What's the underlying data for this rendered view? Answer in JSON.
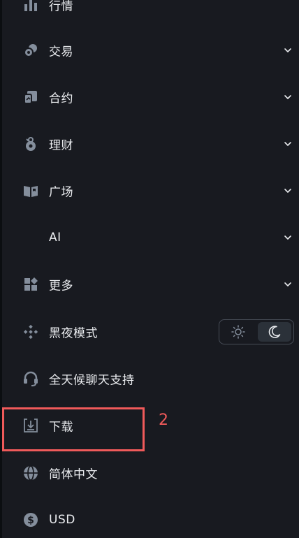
{
  "menu": {
    "items": [
      {
        "id": "market",
        "label": "行情",
        "icon": "bar-chart-icon",
        "chevron": false
      },
      {
        "id": "trade",
        "label": "交易",
        "icon": "trade-icon",
        "chevron": true
      },
      {
        "id": "contract",
        "label": "合约",
        "icon": "contract-icon",
        "chevron": true
      },
      {
        "id": "finance",
        "label": "理财",
        "icon": "finance-icon",
        "chevron": true
      },
      {
        "id": "square",
        "label": "广场",
        "icon": "book-icon",
        "chevron": true
      },
      {
        "id": "ai",
        "label": "AI",
        "icon": "",
        "chevron": true
      },
      {
        "id": "more",
        "label": "更多",
        "icon": "grid-icon",
        "chevron": true
      },
      {
        "id": "dark-mode",
        "label": "黑夜模式",
        "icon": "diamond-icon",
        "chevron": false
      },
      {
        "id": "support",
        "label": "全天候聊天支持",
        "icon": "headset-icon",
        "chevron": false
      },
      {
        "id": "download",
        "label": "下载",
        "icon": "download-icon",
        "chevron": false
      },
      {
        "id": "language",
        "label": "简体中文",
        "icon": "globe-icon",
        "chevron": false
      },
      {
        "id": "currency",
        "label": "USD",
        "icon": "dollar-icon",
        "chevron": false
      }
    ]
  },
  "theme_toggle": {
    "light_icon": "sun-icon",
    "dark_icon": "moon-icon",
    "selected": "dark"
  },
  "annotation": {
    "number": "2",
    "color": "#f05a5a"
  },
  "colors": {
    "background": "#181a20",
    "text": "#eaecef",
    "icon": "#848e9c",
    "toggle_border": "#474d57",
    "toggle_active": "#2b3139"
  }
}
